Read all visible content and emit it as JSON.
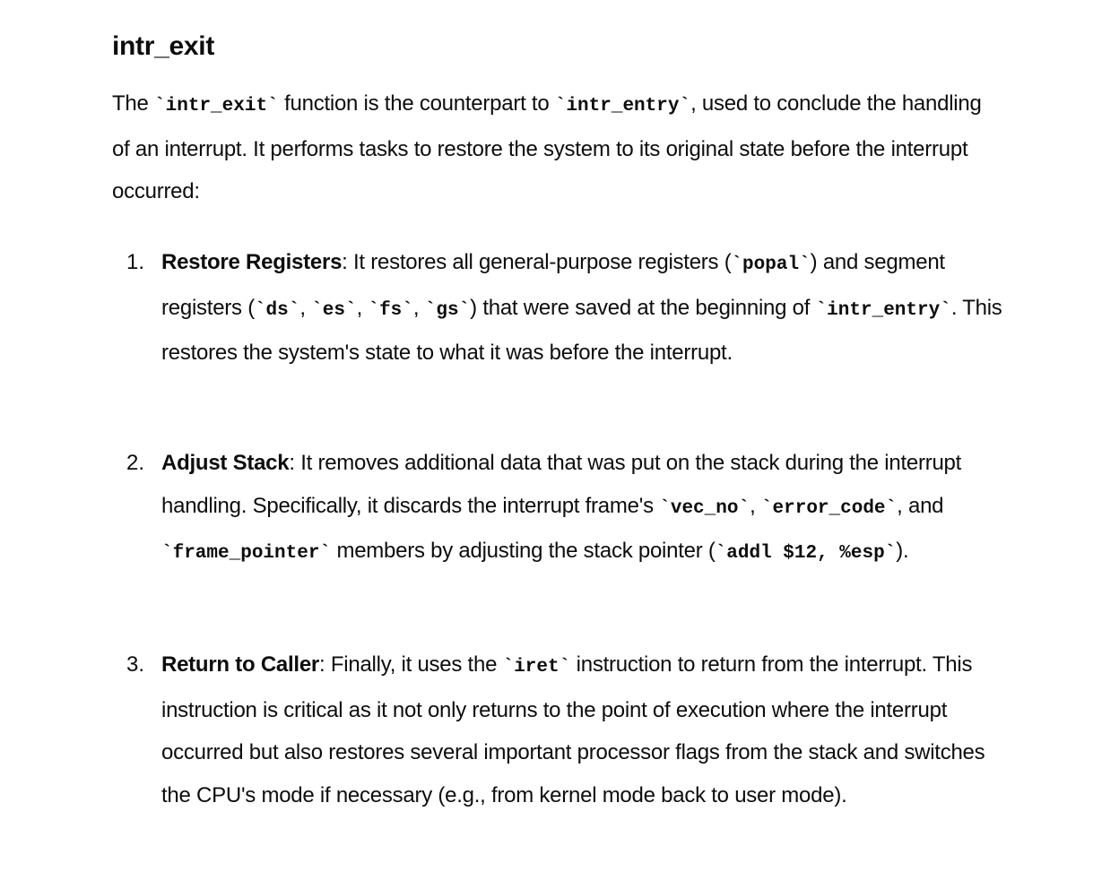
{
  "heading": "intr_exit",
  "intro": {
    "t1": "The ",
    "c1": "`intr_exit`",
    "t2": " function is the counterpart to ",
    "c2": "`intr_entry`",
    "t3": ", used to conclude the handling of an interrupt. It performs tasks to restore the system to its original state before the interrupt occurred:"
  },
  "items": [
    {
      "number": "1.",
      "title": "Restore Registers",
      "t1": ": It restores all general-purpose registers (",
      "c1": "`popal`",
      "t2": ") and segment registers (",
      "c2": "`ds`",
      "t3": ", ",
      "c3": "`es`",
      "t4": ", ",
      "c4": "`fs`",
      "t5": ", ",
      "c5": "`gs`",
      "t6": ") that were saved at the beginning of ",
      "c6": "`intr_entry`",
      "t7": ". This restores the system's state to what it was before the interrupt."
    },
    {
      "number": "2.",
      "title": "Adjust Stack",
      "t1": ": It removes additional data that was put on the stack during the interrupt handling. Specifically, it discards the interrupt frame's ",
      "c1": "`vec_no`",
      "t2": ", ",
      "c2": "`error_code`",
      "t3": ", and ",
      "c3": "`frame_pointer`",
      "t4": " members by adjusting the stack pointer (",
      "c4": "`addl $12, %esp`",
      "t5": ")."
    },
    {
      "number": "3.",
      "title": "Return to Caller",
      "t1": ": Finally, it uses the ",
      "c1": "`iret`",
      "t2": " instruction to return from the interrupt. This instruction is critical as it not only returns to the point of execution where the interrupt occurred but also restores several important processor flags from the stack and switches the CPU's mode if necessary (e.g., from kernel mode back to user mode)."
    }
  ]
}
